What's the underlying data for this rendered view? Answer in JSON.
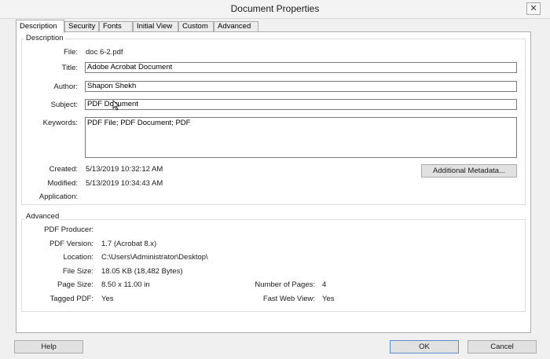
{
  "window": {
    "title": "Document Properties",
    "close_glyph": "✕"
  },
  "tabs": [
    "Description",
    "Security",
    "Fonts",
    "Initial View",
    "Custom",
    "Advanced"
  ],
  "description": {
    "legend": "Description",
    "file_label": "File:",
    "file_value": "doc 6-2.pdf",
    "title_label": "Title:",
    "title_value": "Adobe Acrobat Document",
    "author_label": "Author:",
    "author_value": "Shapon Shekh",
    "subject_label": "Subject:",
    "subject_value": "PDF Document",
    "keywords_label": "Keywords:",
    "keywords_value": "PDF File; PDF Document; PDF",
    "created_label": "Created:",
    "created_value": "5/13/2019 10:32:12 AM",
    "modified_label": "Modified:",
    "modified_value": "5/13/2019 10:34:43 AM",
    "application_label": "Application:",
    "application_value": "",
    "metadata_button": "Additional Metadata..."
  },
  "advanced": {
    "legend": "Advanced",
    "producer_label": "PDF Producer:",
    "producer_value": "",
    "version_label": "PDF Version:",
    "version_value": "1.7 (Acrobat 8.x)",
    "location_label": "Location:",
    "location_value": "C:\\Users\\Administrator\\Desktop\\",
    "filesize_label": "File Size:",
    "filesize_value": "18.05 KB (18,482 Bytes)",
    "pagesize_label": "Page Size:",
    "pagesize_value": "8.50 x 11.00 in",
    "numpages_label": "Number of Pages:",
    "numpages_value": "4",
    "tagged_label": "Tagged PDF:",
    "tagged_value": "Yes",
    "fastweb_label": "Fast Web View:",
    "fastweb_value": "Yes"
  },
  "footer": {
    "help": "Help",
    "ok": "OK",
    "cancel": "Cancel"
  }
}
